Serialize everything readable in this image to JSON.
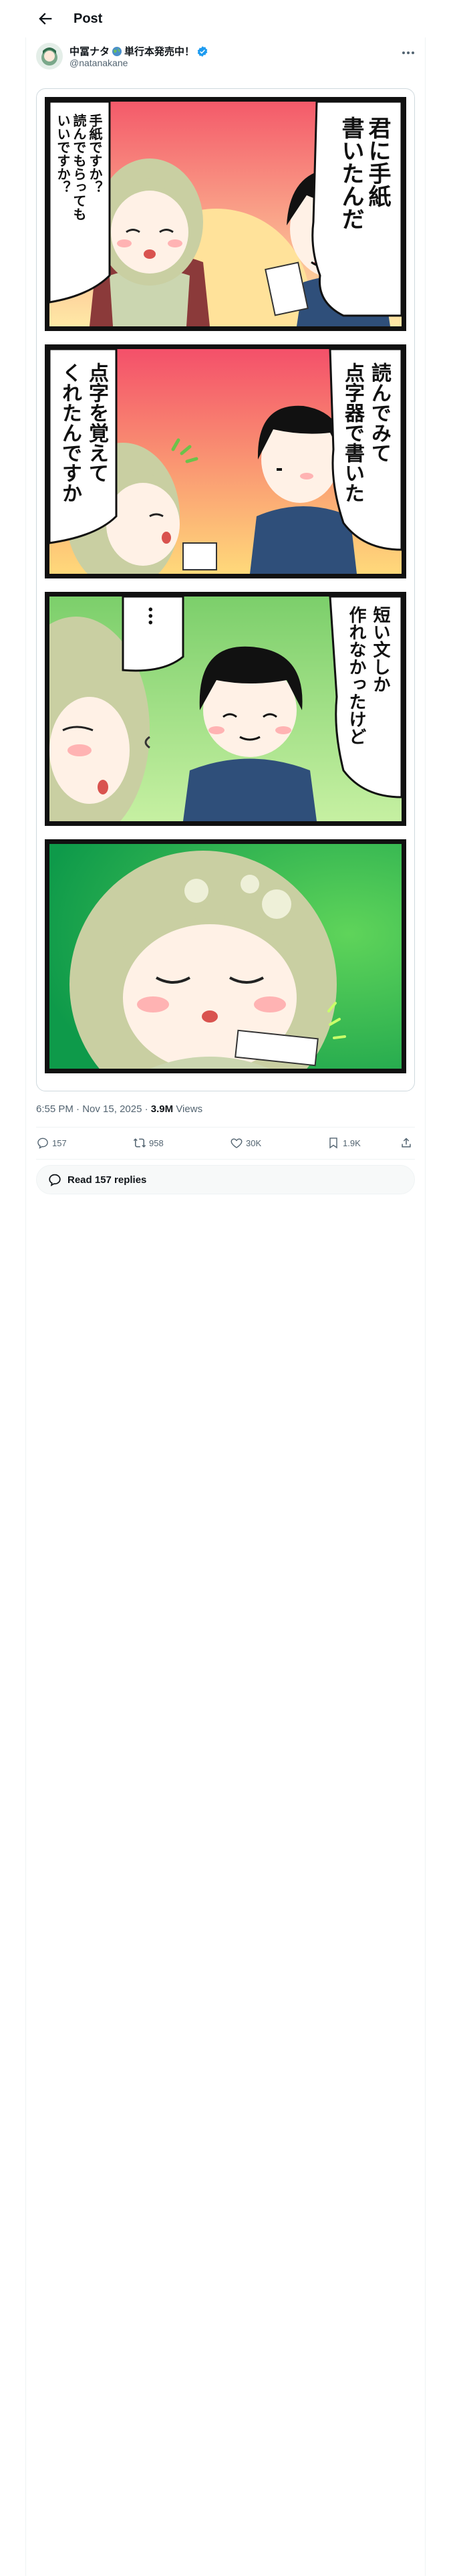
{
  "header": {
    "title": "Post",
    "back_icon": "arrow-left-icon"
  },
  "author": {
    "name": "中冨ナタ",
    "name_suffix": "単行本発売中！",
    "handle": "@natanakane",
    "verified": true,
    "verified_color": "#1d9bf0"
  },
  "comic": {
    "panels": [
      {
        "bubble_right": "君に手紙\n書いたんだ",
        "bubble_left": "手紙ですか？\n読んでもらっても\nいいですか？"
      },
      {
        "bubble_right": "読んでみて\n点字器で書いた",
        "bubble_left": "点字を覚えて\nくれたんですか"
      },
      {
        "bubble_right": "短い文しか\n作れなかったけど",
        "bubble_left": "…"
      },
      {
        "bubble_right": "",
        "bubble_left": ""
      }
    ]
  },
  "meta": {
    "time": "6:55 PM",
    "date": "Nov 15, 2025",
    "views_count": "3.9M",
    "views_label": "Views"
  },
  "actions": {
    "replies": "157",
    "reposts": "958",
    "likes": "30K",
    "bookmarks": "1.9K"
  },
  "read_replies": "Read 157 replies",
  "colors": {
    "accent": "#1d9bf0",
    "secondary_text": "#536471"
  }
}
